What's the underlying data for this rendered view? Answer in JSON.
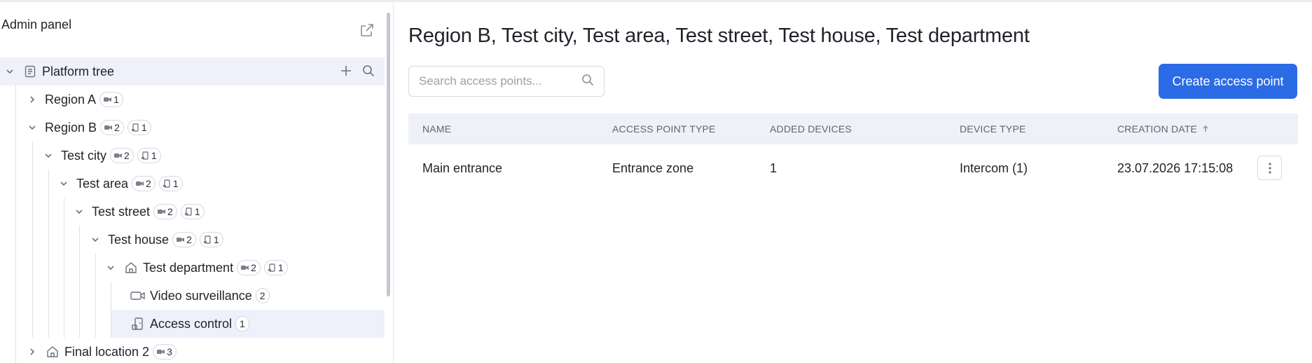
{
  "sidebar": {
    "title": "Admin panel",
    "tree_header": "Platform tree",
    "items": [
      {
        "label": "Region A",
        "cams": "1"
      },
      {
        "label": "Region B",
        "cams": "2",
        "doors": "1"
      },
      {
        "label": "Test city",
        "cams": "2",
        "doors": "1"
      },
      {
        "label": "Test area",
        "cams": "2",
        "doors": "1"
      },
      {
        "label": "Test street",
        "cams": "2",
        "doors": "1"
      },
      {
        "label": "Test house",
        "cams": "2",
        "doors": "1"
      },
      {
        "label": "Test department",
        "cams": "2",
        "doors": "1"
      },
      {
        "label": "Video surveillance",
        "count": "2"
      },
      {
        "label": "Access control",
        "count": "1"
      },
      {
        "label": "Final location 2",
        "cams": "3"
      }
    ]
  },
  "main": {
    "title": "Region B, Test city, Test area, Test street, Test house, Test department",
    "search_placeholder": "Search access points...",
    "create_button": "Create access point",
    "columns": [
      "NAME",
      "ACCESS POINT TYPE",
      "ADDED DEVICES",
      "DEVICE TYPE",
      "CREATION DATE"
    ],
    "rows": [
      {
        "name": "Main entrance",
        "type": "Entrance zone",
        "devices": "1",
        "device_type": "Intercom (1)",
        "created": "23.07.2026 17:15:08"
      }
    ]
  },
  "colors": {
    "accent": "#2c6be6",
    "selected_bg": "#eef1fb",
    "header_bg": "#eef1f8"
  }
}
